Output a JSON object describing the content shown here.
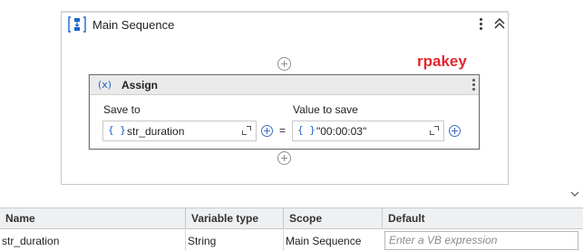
{
  "sequence": {
    "title": "Main Sequence",
    "icon": "sequence-icon"
  },
  "watermark": "rpakey",
  "assign": {
    "icon_text": "(x)",
    "title": "Assign",
    "save_to_label": "Save to",
    "value_label": "Value to save",
    "save_to_value": "str_duration",
    "value_value": "\"00:00:03\"",
    "braces": "{ }",
    "equals": "="
  },
  "variables": {
    "columns": [
      "Name",
      "Variable type",
      "Scope",
      "Default"
    ],
    "rows": [
      {
        "name": "str_duration",
        "type": "String",
        "scope": "Main Sequence",
        "default_placeholder": "Enter a VB expression"
      }
    ]
  },
  "colors": {
    "accent": "#1a66c9",
    "watermark": "#e3262f"
  }
}
